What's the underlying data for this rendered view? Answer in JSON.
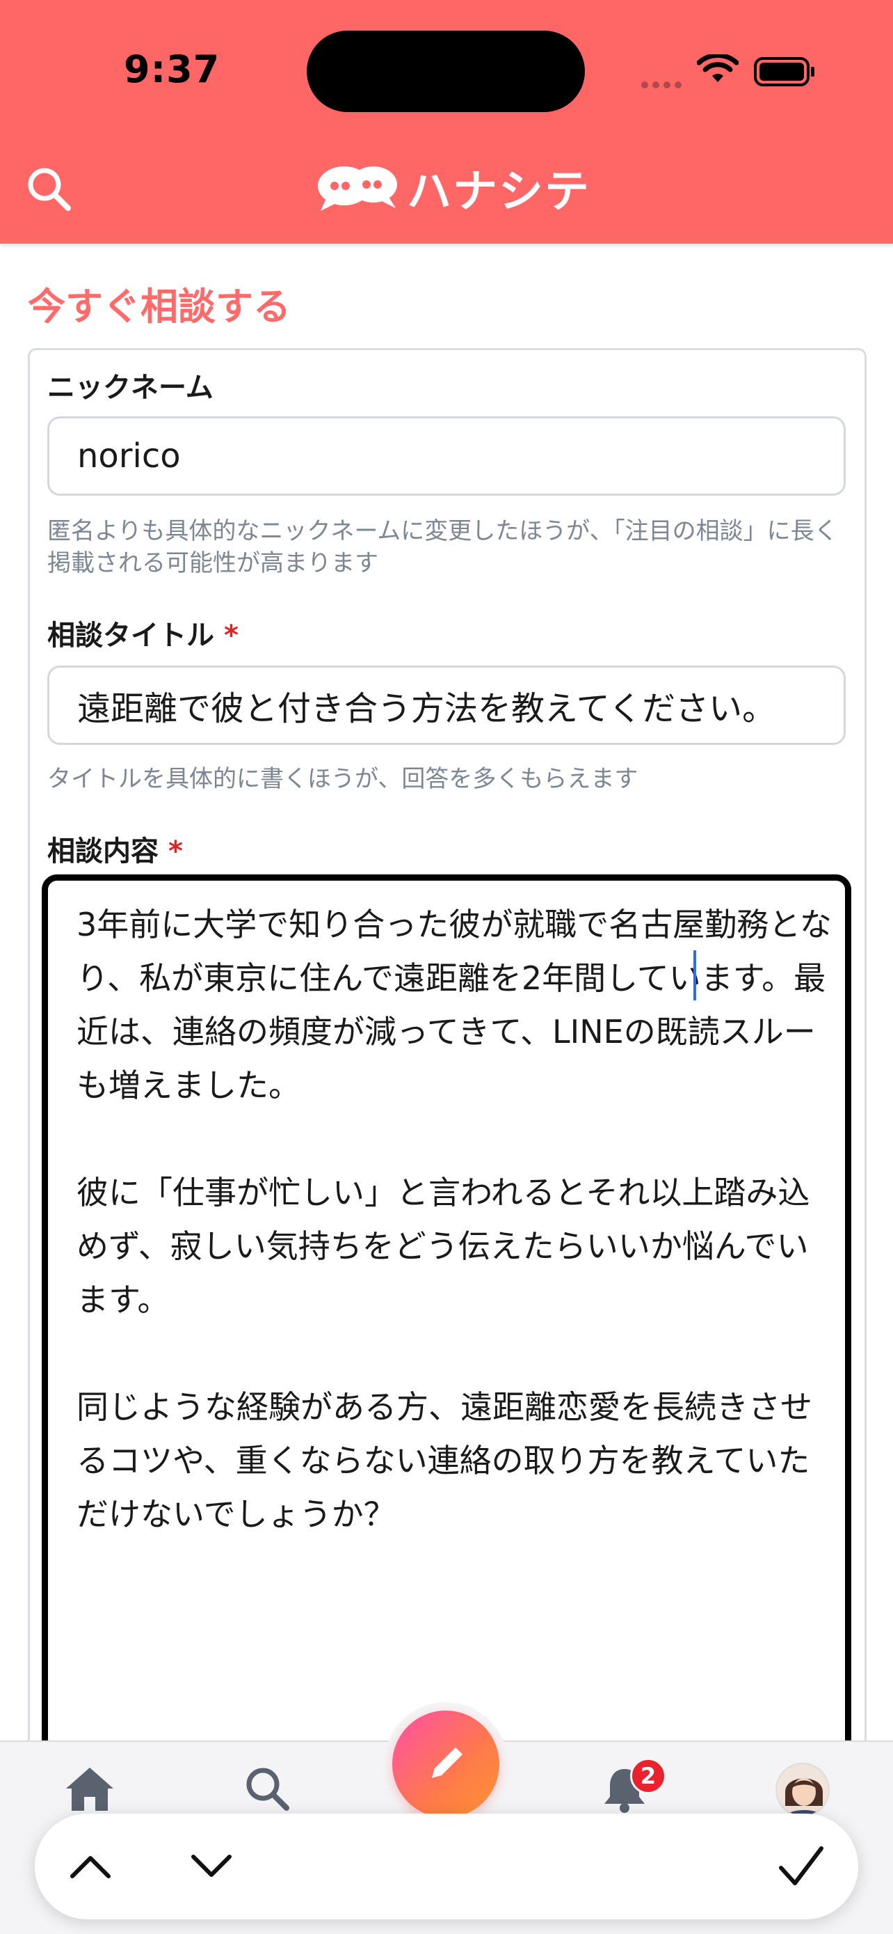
{
  "status_bar": {
    "time": "9:37"
  },
  "header": {
    "app_name": "ハナシテ",
    "brand_color": "#ff6666"
  },
  "form": {
    "page_title": "今すぐ相談する",
    "nickname": {
      "label": "ニックネーム",
      "value": "norico",
      "hint": "匿名よりも具体的なニックネームに変更したほうが、「注目の相談」に長く掲載される可能性が高まります"
    },
    "title": {
      "label": "相談タイトル",
      "required_mark": "*",
      "value": "遠距離で彼と付き合う方法を教えてください。",
      "hint": "タイトルを具体的に書くほうが、回答を多くもらえます"
    },
    "content": {
      "label": "相談内容",
      "required_mark": "*",
      "value": "3年前に大学で知り合った彼が就職で名古屋勤務となり、私が東京に住んで遠距離を2年間しています。最近は、連絡の頻度が減ってきて、LINEの既読スルーも増えました。\n\n彼に「仕事が忙しい」と言われるとそれ以上踏み込めず、寂しい気持ちをどう伝えたらいいか悩んでいます。\n\n同じような経験がある方、遠距離恋愛を長続きさせるコツや、重くならない連絡の取り方を教えていただけないでしょうか？"
    }
  },
  "tab_bar": {
    "notification_count": "2",
    "accent_color": "#ff5555"
  },
  "keyboard_accessory": {
    "previous_icon": "chevron-up-icon",
    "next_icon": "chevron-down-icon",
    "done_icon": "checkmark-icon"
  }
}
